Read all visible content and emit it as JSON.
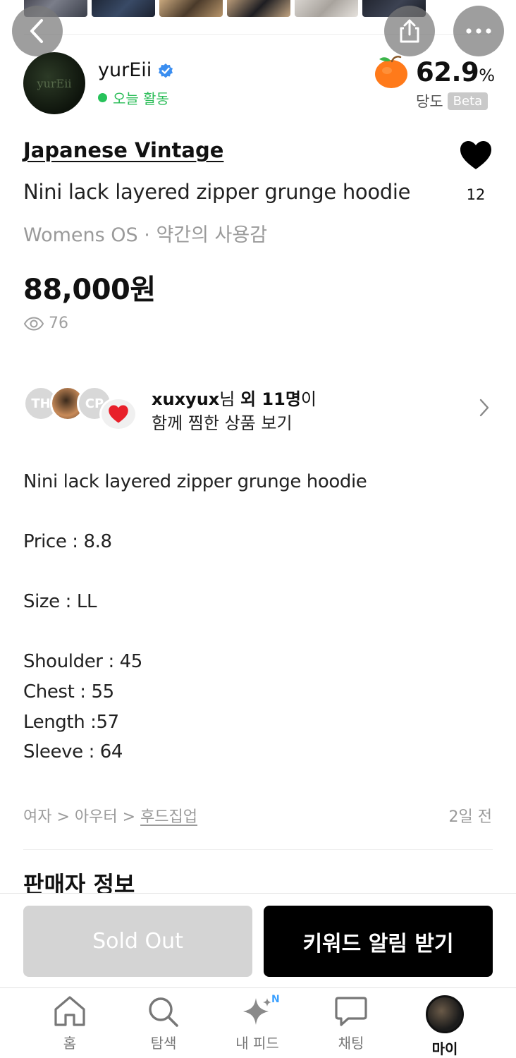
{
  "header": {
    "back_icon": "chevron-left-icon",
    "share_icon": "share-icon",
    "more_icon": "more-dots-icon"
  },
  "seller": {
    "avatar_text": "yurEii",
    "name": "yurEii",
    "verified_icon": "verified-check-icon",
    "activity": "오늘 활동",
    "sweetness_value": "62.9",
    "sweetness_unit": "%",
    "sweetness_label": "당도",
    "beta_badge": "Beta",
    "sweet_icon": "orange-fruit-icon"
  },
  "product": {
    "brand": "Japanese Vintage",
    "title": "Nini lack layered zipper grunge hoodie",
    "meta": "Womens OS · 약간의 사용감",
    "price": "88,000원",
    "views": "76",
    "like_count": "12"
  },
  "wishers": {
    "avatar1_initials": "TH",
    "avatar3_initials": "CP",
    "user": "xuxyux",
    "honorific": "님 ",
    "others": "외 11명",
    "suffix": "이",
    "line2": "함께 찜한 상품 보기"
  },
  "description": {
    "lines": [
      "Nini lack layered zipper grunge hoodie",
      "Price : 8.8",
      "Size : LL",
      "Shoulder : 45",
      "Chest : 55",
      "Length :57",
      "Sleeve : 64"
    ]
  },
  "category": {
    "path1": "여자",
    "sep": " > ",
    "path2": "아우터",
    "path3": "후드집업",
    "posted": "2일 전"
  },
  "seller_section_title": "판매자 정보",
  "actions": {
    "sold_out": "Sold Out",
    "keyword_alert": "키워드 알림 받기"
  },
  "tabs": [
    {
      "label": "홈",
      "icon": "home-icon"
    },
    {
      "label": "탐색",
      "icon": "search-icon"
    },
    {
      "label": "내 피드",
      "icon": "sparkle-icon",
      "badge": "N"
    },
    {
      "label": "채팅",
      "icon": "chat-bubble-icon"
    },
    {
      "label": "마이",
      "icon": "profile-avatar"
    }
  ],
  "colors": {
    "active_green": "#27c25a",
    "verified_blue": "#3b8ef0",
    "sold_out_bg": "#d4d4d4",
    "primary_black": "#000000"
  }
}
